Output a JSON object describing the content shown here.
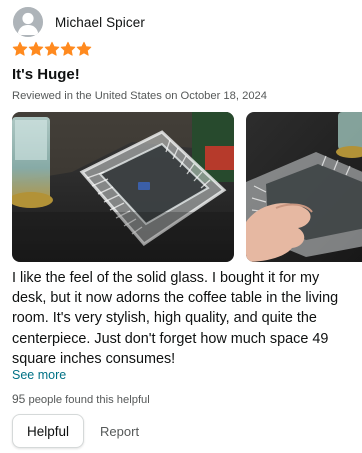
{
  "review": {
    "reviewer_name": "Michael Spicer",
    "rating": 5,
    "star_color": "#ff8a1f",
    "title": "It's Huge!",
    "meta": "Reviewed in the United States on October 18, 2024",
    "images": [
      "review-photo-glass-ashtray-on-table",
      "review-photo-glass-ashtray-in-hand"
    ],
    "body": "I like the feel of the solid glass. I bought it for my desk, but it now adorns the coffee table in the living room. It's very stylish, high quality, and quite the centerpiece. Just don't forget how much space 49 square inches consumes!",
    "see_more": "See more",
    "helpful_count": "95",
    "helpful_suffix": " people found this helpful",
    "helpful_button": "Helpful",
    "report_link": "Report"
  },
  "colors": {
    "link": "#007185",
    "secondary_text": "#565959"
  }
}
